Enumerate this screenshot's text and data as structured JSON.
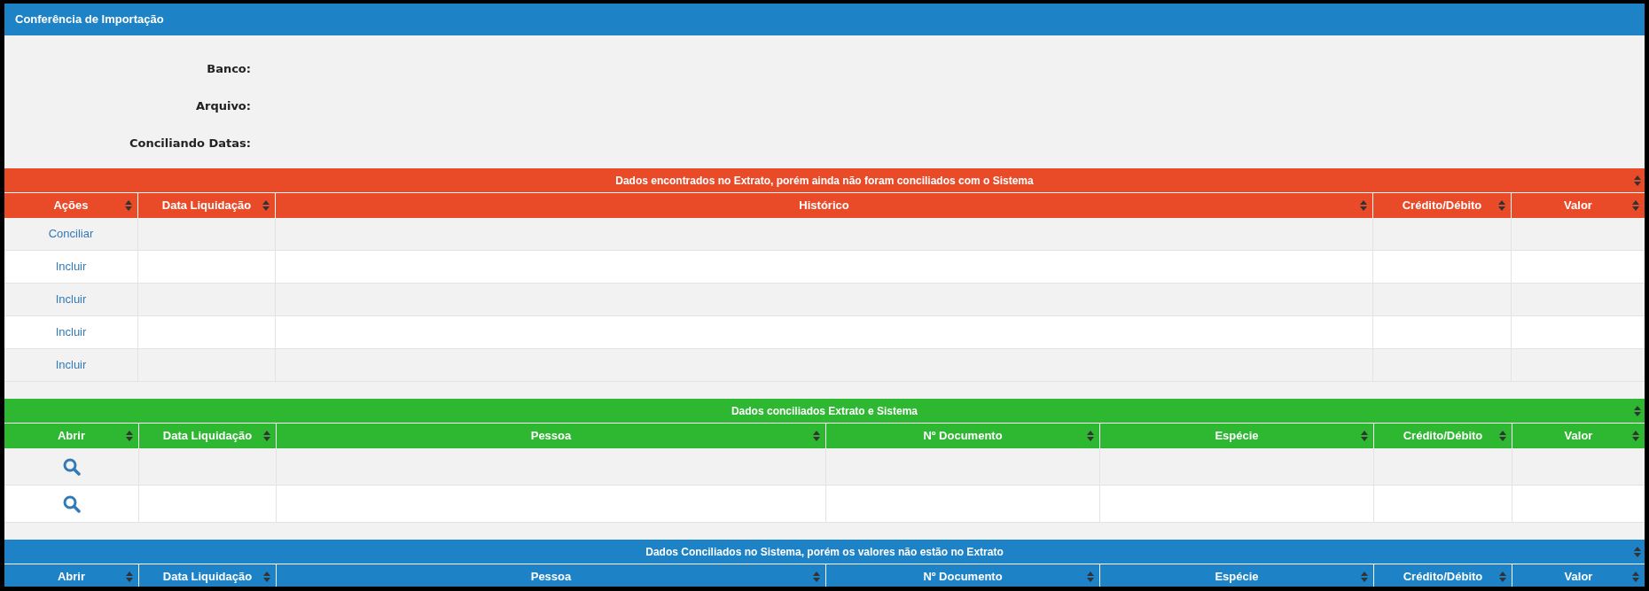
{
  "window": {
    "title": "Conferência de Importação"
  },
  "info": [
    {
      "label": "Banco:"
    },
    {
      "label": "Arquivo:"
    },
    {
      "label": "Conciliando Datas:"
    }
  ],
  "sections": [
    {
      "title": "Dados encontrados no Extrato, porém ainda não foram conciliados com o Sistema",
      "color": "#e94b29",
      "columns": [
        {
          "label": "Ações"
        },
        {
          "label": "Data Liquidação"
        },
        {
          "label": "Histórico"
        },
        {
          "label": "Crédito/Débito"
        },
        {
          "label": "Valor"
        }
      ],
      "rows": [
        {
          "action": {
            "kind": "link",
            "label": "Conciliar"
          }
        },
        {
          "action": {
            "kind": "link",
            "label": "Incluir"
          }
        },
        {
          "action": {
            "kind": "link",
            "label": "Incluir"
          }
        },
        {
          "action": {
            "kind": "link",
            "label": "Incluir"
          }
        },
        {
          "action": {
            "kind": "link",
            "label": "Incluir"
          }
        }
      ]
    },
    {
      "title": "Dados conciliados Extrato e Sistema",
      "color": "#2eb731",
      "columns": [
        {
          "label": "Abrir"
        },
        {
          "label": "Data Liquidação"
        },
        {
          "label": "Pessoa"
        },
        {
          "label": "Nº Documento"
        },
        {
          "label": "Espécie"
        },
        {
          "label": "Crédito/Débito"
        },
        {
          "label": "Valor"
        }
      ],
      "rows": [
        {
          "action": {
            "kind": "search"
          }
        },
        {
          "action": {
            "kind": "search"
          }
        }
      ]
    },
    {
      "title": "Dados Conciliados no Sistema, porém os valores não estão no Extrato",
      "color": "#1d82c6",
      "columns": [
        {
          "label": "Abrir"
        },
        {
          "label": "Data Liquidação"
        },
        {
          "label": "Pessoa"
        },
        {
          "label": "Nº Documento"
        },
        {
          "label": "Espécie"
        },
        {
          "label": "Crédito/Débito"
        },
        {
          "label": "Valor"
        }
      ]
    }
  ]
}
